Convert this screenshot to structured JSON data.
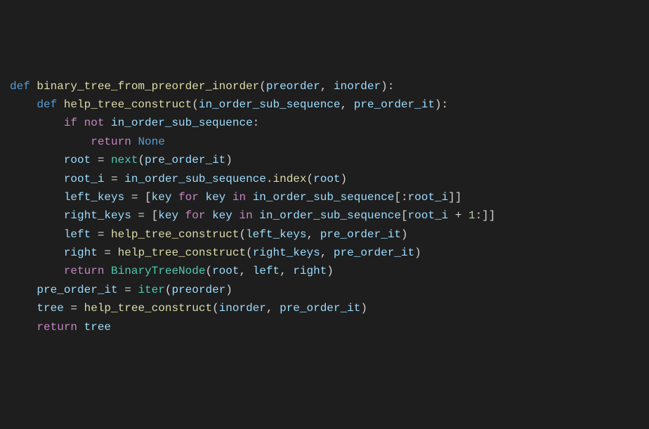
{
  "code": {
    "language": "python",
    "lines": [
      {
        "indent": 0,
        "tokens": [
          {
            "t": "def ",
            "c": "kw-def"
          },
          {
            "t": "binary_tree_from_preorder_inorder",
            "c": "fn"
          },
          {
            "t": "(",
            "c": "punct"
          },
          {
            "t": "preorder",
            "c": "param"
          },
          {
            "t": ", ",
            "c": "punct"
          },
          {
            "t": "inorder",
            "c": "param"
          },
          {
            "t": "):",
            "c": "punct"
          }
        ]
      },
      {
        "indent": 1,
        "tokens": [
          {
            "t": "def ",
            "c": "kw-def"
          },
          {
            "t": "help_tree_construct",
            "c": "fn"
          },
          {
            "t": "(",
            "c": "punct"
          },
          {
            "t": "in_order_sub_sequence",
            "c": "param"
          },
          {
            "t": ", ",
            "c": "punct"
          },
          {
            "t": "pre_order_it",
            "c": "param"
          },
          {
            "t": "):",
            "c": "punct"
          }
        ]
      },
      {
        "indent": 2,
        "tokens": [
          {
            "t": "if ",
            "c": "kw-ctrl"
          },
          {
            "t": "not ",
            "c": "kw-ctrl"
          },
          {
            "t": "in_order_sub_sequence",
            "c": "var"
          },
          {
            "t": ":",
            "c": "punct"
          }
        ]
      },
      {
        "indent": 3,
        "tokens": [
          {
            "t": "return ",
            "c": "kw-ctrl"
          },
          {
            "t": "None",
            "c": "const"
          }
        ]
      },
      {
        "indent": 0,
        "tokens": [
          {
            "t": "",
            "c": "punct"
          }
        ]
      },
      {
        "indent": 2,
        "tokens": [
          {
            "t": "root",
            "c": "var"
          },
          {
            "t": " = ",
            "c": "op"
          },
          {
            "t": "next",
            "c": "cls"
          },
          {
            "t": "(",
            "c": "punct"
          },
          {
            "t": "pre_order_it",
            "c": "var"
          },
          {
            "t": ")",
            "c": "punct"
          }
        ]
      },
      {
        "indent": 2,
        "tokens": [
          {
            "t": "root_i",
            "c": "var"
          },
          {
            "t": " = ",
            "c": "op"
          },
          {
            "t": "in_order_sub_sequence",
            "c": "var"
          },
          {
            "t": ".",
            "c": "punct"
          },
          {
            "t": "index",
            "c": "fn"
          },
          {
            "t": "(",
            "c": "punct"
          },
          {
            "t": "root",
            "c": "var"
          },
          {
            "t": ")",
            "c": "punct"
          }
        ]
      },
      {
        "indent": 0,
        "tokens": [
          {
            "t": "",
            "c": "punct"
          }
        ]
      },
      {
        "indent": 2,
        "tokens": [
          {
            "t": "left_keys",
            "c": "var"
          },
          {
            "t": " = [",
            "c": "op"
          },
          {
            "t": "key",
            "c": "var"
          },
          {
            "t": " ",
            "c": "op"
          },
          {
            "t": "for ",
            "c": "kw-ctrl"
          },
          {
            "t": "key",
            "c": "var"
          },
          {
            "t": " ",
            "c": "op"
          },
          {
            "t": "in ",
            "c": "kw-ctrl"
          },
          {
            "t": "in_order_sub_sequence",
            "c": "var"
          },
          {
            "t": "[:",
            "c": "punct"
          },
          {
            "t": "root_i",
            "c": "var"
          },
          {
            "t": "]]",
            "c": "punct"
          }
        ]
      },
      {
        "indent": 2,
        "tokens": [
          {
            "t": "right_keys",
            "c": "var"
          },
          {
            "t": " = [",
            "c": "op"
          },
          {
            "t": "key",
            "c": "var"
          },
          {
            "t": " ",
            "c": "op"
          },
          {
            "t": "for ",
            "c": "kw-ctrl"
          },
          {
            "t": "key",
            "c": "var"
          },
          {
            "t": " ",
            "c": "op"
          },
          {
            "t": "in ",
            "c": "kw-ctrl"
          },
          {
            "t": "in_order_sub_sequence",
            "c": "var"
          },
          {
            "t": "[",
            "c": "punct"
          },
          {
            "t": "root_i",
            "c": "var"
          },
          {
            "t": " + ",
            "c": "op"
          },
          {
            "t": "1",
            "c": "num"
          },
          {
            "t": ":]]",
            "c": "punct"
          }
        ]
      },
      {
        "indent": 0,
        "tokens": [
          {
            "t": "",
            "c": "punct"
          }
        ]
      },
      {
        "indent": 2,
        "tokens": [
          {
            "t": "left",
            "c": "var"
          },
          {
            "t": " = ",
            "c": "op"
          },
          {
            "t": "help_tree_construct",
            "c": "fn"
          },
          {
            "t": "(",
            "c": "punct"
          },
          {
            "t": "left_keys",
            "c": "var"
          },
          {
            "t": ", ",
            "c": "punct"
          },
          {
            "t": "pre_order_it",
            "c": "var"
          },
          {
            "t": ")",
            "c": "punct"
          }
        ]
      },
      {
        "indent": 2,
        "tokens": [
          {
            "t": "right",
            "c": "var"
          },
          {
            "t": " = ",
            "c": "op"
          },
          {
            "t": "help_tree_construct",
            "c": "fn"
          },
          {
            "t": "(",
            "c": "punct"
          },
          {
            "t": "right_keys",
            "c": "var"
          },
          {
            "t": ", ",
            "c": "punct"
          },
          {
            "t": "pre_order_it",
            "c": "var"
          },
          {
            "t": ")",
            "c": "punct"
          }
        ]
      },
      {
        "indent": 0,
        "tokens": [
          {
            "t": "",
            "c": "punct"
          }
        ]
      },
      {
        "indent": 2,
        "tokens": [
          {
            "t": "return ",
            "c": "kw-ctrl"
          },
          {
            "t": "BinaryTreeNode",
            "c": "cls"
          },
          {
            "t": "(",
            "c": "punct"
          },
          {
            "t": "root",
            "c": "var"
          },
          {
            "t": ", ",
            "c": "punct"
          },
          {
            "t": "left",
            "c": "var"
          },
          {
            "t": ", ",
            "c": "punct"
          },
          {
            "t": "right",
            "c": "var"
          },
          {
            "t": ")",
            "c": "punct"
          }
        ]
      },
      {
        "indent": 0,
        "tokens": [
          {
            "t": "",
            "c": "punct"
          }
        ]
      },
      {
        "indent": 1,
        "tokens": [
          {
            "t": "pre_order_it",
            "c": "var"
          },
          {
            "t": " = ",
            "c": "op"
          },
          {
            "t": "iter",
            "c": "cls"
          },
          {
            "t": "(",
            "c": "punct"
          },
          {
            "t": "preorder",
            "c": "var"
          },
          {
            "t": ")",
            "c": "punct"
          }
        ]
      },
      {
        "indent": 1,
        "tokens": [
          {
            "t": "tree",
            "c": "var"
          },
          {
            "t": " = ",
            "c": "op"
          },
          {
            "t": "help_tree_construct",
            "c": "fn"
          },
          {
            "t": "(",
            "c": "punct"
          },
          {
            "t": "inorder",
            "c": "var"
          },
          {
            "t": ", ",
            "c": "punct"
          },
          {
            "t": "pre_order_it",
            "c": "var"
          },
          {
            "t": ")",
            "c": "punct"
          }
        ]
      },
      {
        "indent": 1,
        "tokens": [
          {
            "t": "return ",
            "c": "kw-ctrl"
          },
          {
            "t": "tree",
            "c": "var"
          }
        ]
      }
    ]
  }
}
